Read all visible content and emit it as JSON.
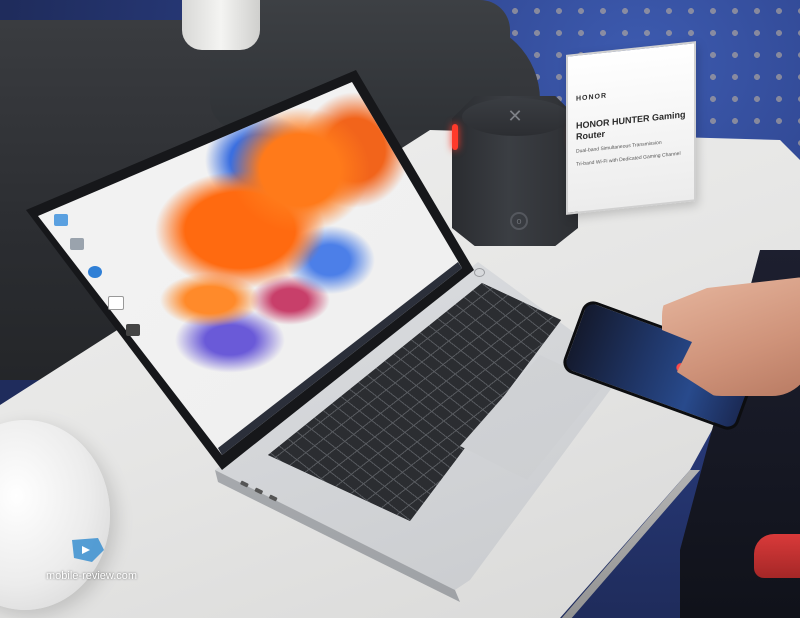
{
  "photo": {
    "sign": {
      "brand": "HONOR",
      "title": "HONOR HUNTER Gaming Router",
      "lines": [
        "Dual-band Simultaneous Transmission",
        "Tri-band Wi-Fi with Dedicated Gaming Channel"
      ]
    },
    "watermark": "mobile-review.com",
    "icons": {
      "router_logo": "hunter-logo-icon",
      "watermark_logo": "mobile-review-logo-icon"
    },
    "colors": {
      "router_led": "#ff3a2a",
      "screen_orange": "#ff6a10",
      "screen_blue": "#3b6fe0"
    }
  }
}
